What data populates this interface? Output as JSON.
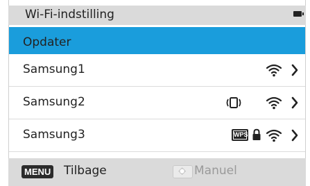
{
  "header": {
    "title": "Wi-Fi-indstilling",
    "battery_icon": "battery-full-icon"
  },
  "update": {
    "label": "Opdater"
  },
  "networks": [
    {
      "ssid": "Samsung1",
      "icons": [
        "wifi-signal-icon",
        "chevron-right-icon"
      ]
    },
    {
      "ssid": "Samsung2",
      "icons": [
        "device-signal-icon",
        "wifi-signal-icon",
        "chevron-right-icon"
      ]
    },
    {
      "ssid": "Samsung3",
      "icons": [
        "wps-icon",
        "lock-icon",
        "wifi-signal-icon",
        "chevron-right-icon"
      ],
      "wps_label": "WPS"
    }
  ],
  "footer": {
    "menu_key": "MENU",
    "back_label": "Tilbage",
    "pad_icon": "navigation-pad-icon",
    "manual_label": "Manuel"
  },
  "colors": {
    "selected": "#1a9ddc",
    "bar": "#dadada",
    "disabled_text": "#9a9a9a"
  }
}
